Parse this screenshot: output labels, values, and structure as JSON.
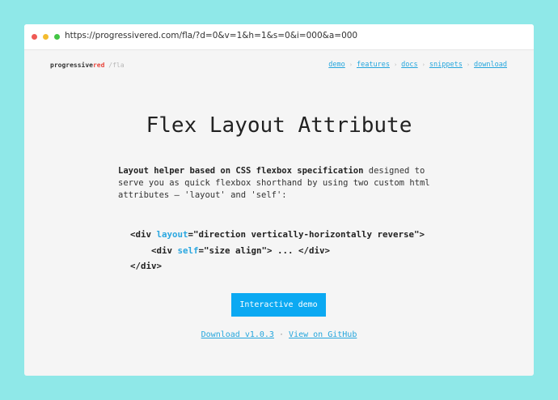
{
  "browser": {
    "url": "https://progressivered.com/fla/?d=0&v=1&h=1&s=0&i=000&a=000"
  },
  "header": {
    "logo_main": "progressive",
    "logo_red": "red",
    "logo_suffix": " /fla",
    "nav": [
      "demo",
      "features",
      "docs",
      "snippets",
      "download"
    ],
    "nav_separator": "›"
  },
  "main": {
    "title": "Flex Layout Attribute",
    "desc_bold": "Layout helper based on CSS flexbox specification",
    "desc_rest": " designed to serve you as quick flexbox shorthand by using two custom html attributes — 'layout' and 'self':",
    "code": {
      "line1_open": "<div ",
      "line1_attr": "layout",
      "line1_value": "=\"direction vertically-horizontally reverse\">",
      "line2_open": "<div ",
      "line2_attr": "self",
      "line2_value": "=\"size align\"> ... </div>",
      "line3": "</div>"
    },
    "button_label": "Interactive demo",
    "download_link": "Download v1.0.3",
    "links_separator": "·",
    "github_link": "View on GitHub"
  },
  "colors": {
    "background": "#8fe8e8",
    "accent": "#0ba9f2",
    "link": "#25a6dd",
    "brand_red": "#e8463c"
  }
}
